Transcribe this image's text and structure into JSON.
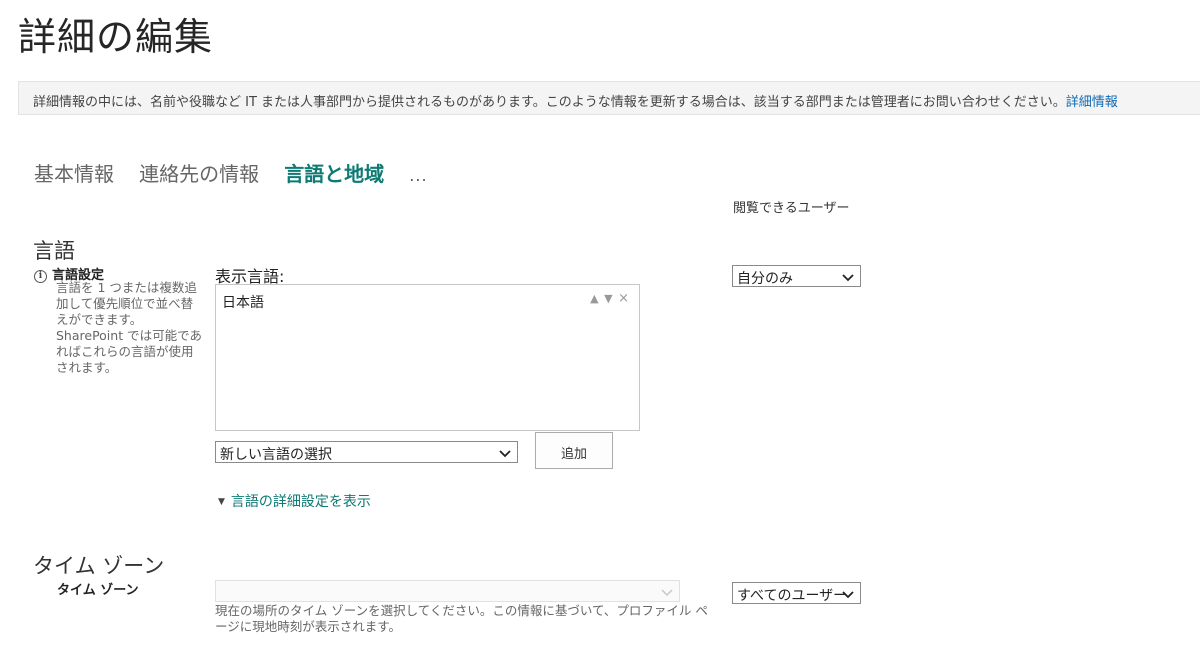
{
  "page": {
    "title": "詳細の編集"
  },
  "info_bar": {
    "text": "詳細情報の中には、名前や役職など IT または人事部門から提供されるものがあります。このような情報を更新する場合は、該当する部門または管理者にお問い合わせください。",
    "link": "詳細情報"
  },
  "tabs": [
    {
      "label": "基本情報",
      "active": false
    },
    {
      "label": "連絡先の情報",
      "active": false
    },
    {
      "label": "言語と地域",
      "active": true
    }
  ],
  "tab_more": "...",
  "viewers_label": "閲覧できるユーザー",
  "language": {
    "section_title": "言語",
    "field_label": "言語設定",
    "info_icon": "i",
    "description": "言語を 1 つまたは複数追加して優先順位で並べ替えができます。SharePoint では可能であればこれらの言語が使用されます。",
    "display_label": "表示言語:",
    "display_languages": [
      "日本語"
    ],
    "up_icon": "▲",
    "down_icon": "▼",
    "remove_icon": "×",
    "new_language_select": "新しい言語の選択",
    "add_button": "追加",
    "advanced_link": "言語の詳細設定を表示",
    "visibility": "自分のみ"
  },
  "timezone": {
    "section_title": "タイム ゾーン",
    "field_label": "タイム ゾーン",
    "select_value": "",
    "description": "現在の場所のタイム ゾーンを選択してください。この情報に基づいて、プロファイル ページに現地時刻が表示されます。",
    "visibility": "すべてのユーザー"
  },
  "colors": {
    "accent": "#0d7a73",
    "link": "#0f6ab4",
    "info_bar_bg": "#f4f4f4"
  }
}
